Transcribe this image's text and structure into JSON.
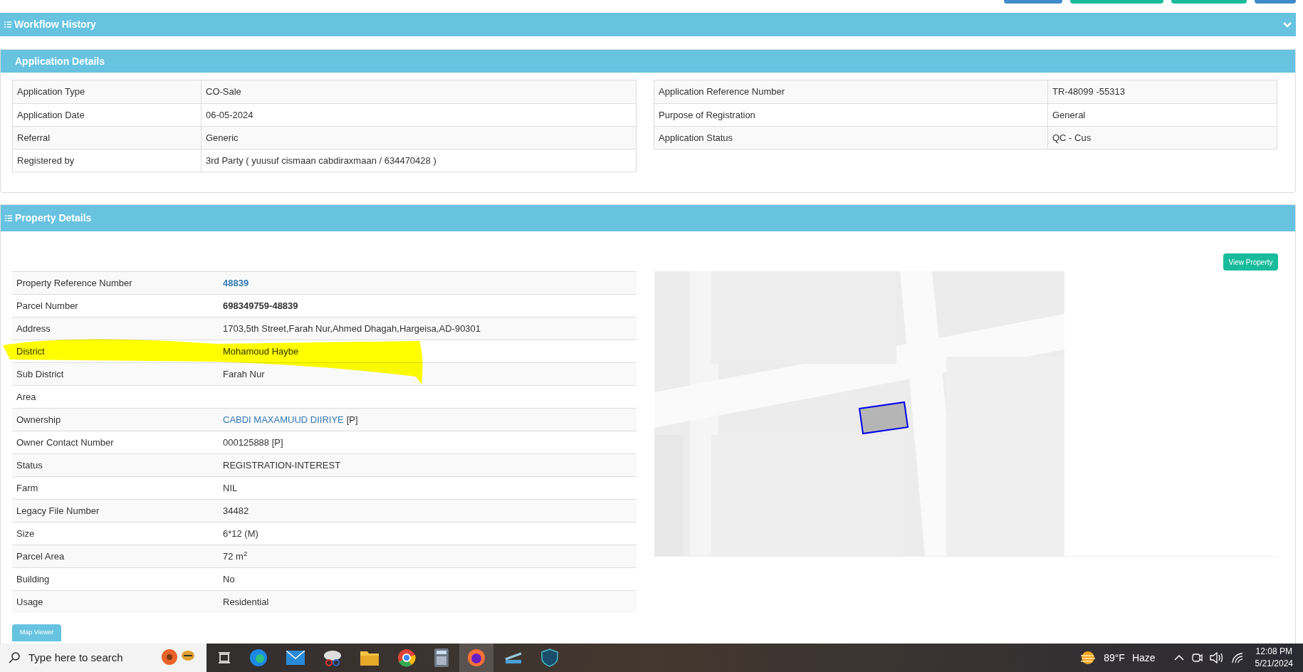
{
  "workflow_history": {
    "title": "Workflow History",
    "expanded": false
  },
  "application_details": {
    "title": "Application Details",
    "left_rows": [
      {
        "label": "Application Type",
        "value": "CO-Sale"
      },
      {
        "label": "Application Date",
        "value": "06-05-2024"
      },
      {
        "label": "Referral",
        "value": "Generic"
      },
      {
        "label": "Registered by",
        "value": "3rd Party ( yuusuf cismaan cabdiraxmaan / 634470428 )"
      }
    ],
    "right_rows": [
      {
        "label": "Application Reference Number",
        "value": "TR-48099 -55313"
      },
      {
        "label": "Purpose of Registration",
        "value": "General"
      },
      {
        "label": "Application Status",
        "value": "QC - Cus"
      }
    ]
  },
  "property_details": {
    "title": "Property Details",
    "view_button": "View Property",
    "map_button": "Map Viewer",
    "rows": [
      {
        "label": "Property Reference Number",
        "value": "48839",
        "kind": "link"
      },
      {
        "label": "Parcel Number",
        "value": "698349759-48839",
        "kind": "bold"
      },
      {
        "label": "Address",
        "value": "1703,5th Street,Farah Nur,Ahmed Dhagah,Hargeisa,AD-90301",
        "kind": "plain"
      },
      {
        "label": "District",
        "value": "Mohamoud Haybe",
        "kind": "plain",
        "highlighted": true
      },
      {
        "label": "Sub District",
        "value": "Farah Nur",
        "kind": "plain"
      },
      {
        "label": "Area"
      },
      {
        "label": "Ownership",
        "value": "CABDI MAXAMUUD DIIRIYE",
        "suffix": "[P]",
        "kind": "link"
      },
      {
        "label": "Owner Contact Number",
        "value": "000125888 [P]",
        "kind": "plain"
      },
      {
        "label": "Status",
        "value": "REGISTRATION-INTEREST",
        "kind": "plain"
      },
      {
        "label": "Farm",
        "value": "NIL",
        "kind": "plain"
      },
      {
        "label": "Legacy File Number",
        "value": "34482",
        "kind": "plain"
      },
      {
        "label": "Size",
        "value": "6*12 (M)",
        "kind": "plain"
      },
      {
        "label": "Parcel Area",
        "value": "72 m$^{2}$",
        "kind": "plain"
      },
      {
        "label": "Building",
        "value": "No",
        "kind": "plain"
      },
      {
        "label": "Usage",
        "value": "Residential",
        "kind": "plain"
      }
    ]
  },
  "taskbar": {
    "search_placeholder": "Type here to search",
    "weather": "89°F",
    "weather_text": "Haze",
    "time": "12:08 PM",
    "date": "5/21/2024"
  }
}
